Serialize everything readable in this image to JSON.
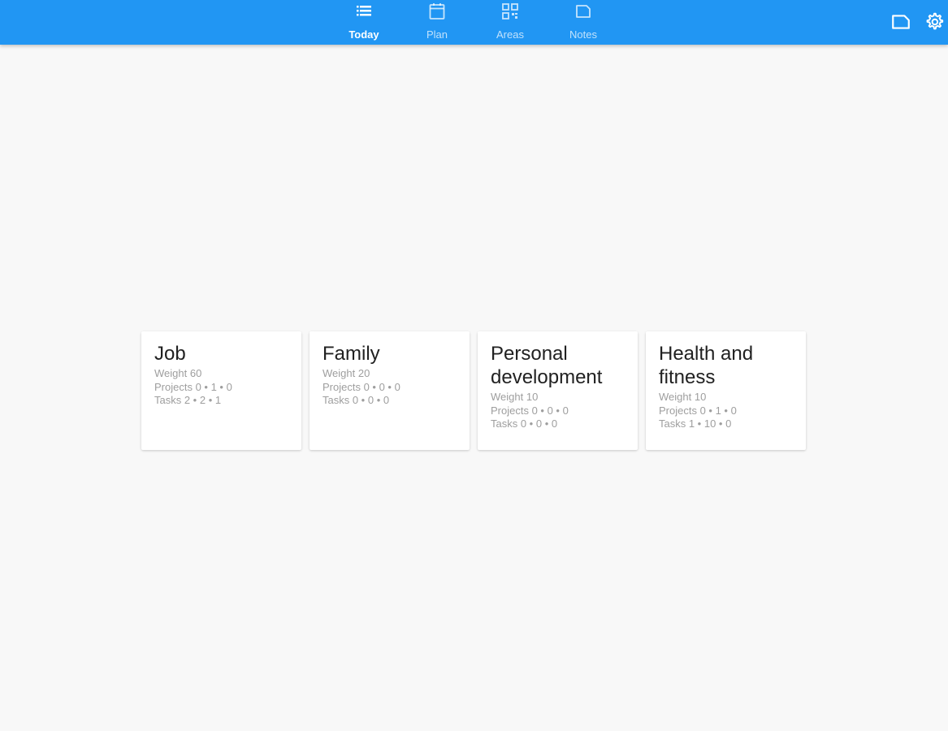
{
  "appbar": {
    "color": "#2196f3",
    "tabs": [
      {
        "label": "Today",
        "icon": "list-icon",
        "active": true
      },
      {
        "label": "Plan",
        "icon": "calendar-icon",
        "active": false
      },
      {
        "label": "Areas",
        "icon": "grid-icon",
        "active": false
      },
      {
        "label": "Notes",
        "icon": "note-icon",
        "active": false
      }
    ],
    "actions": [
      {
        "icon": "note-icon"
      },
      {
        "icon": "gear-icon"
      }
    ]
  },
  "areas": [
    {
      "title": "Job",
      "weight": "Weight 60",
      "projects": "Projects 0 • 1 • 0",
      "tasks": "Tasks 2 • 2 • 1"
    },
    {
      "title": "Family",
      "weight": "Weight 20",
      "projects": "Projects 0 • 0 • 0",
      "tasks": "Tasks 0 • 0 • 0"
    },
    {
      "title": "Personal development",
      "weight": "Weight 10",
      "projects": "Projects 0 • 0 • 0",
      "tasks": "Tasks 0 • 0 • 0"
    },
    {
      "title": "Health and fitness",
      "weight": "Weight 10",
      "projects": "Projects 0 • 1 • 0",
      "tasks": "Tasks 1 • 10 • 0"
    }
  ]
}
